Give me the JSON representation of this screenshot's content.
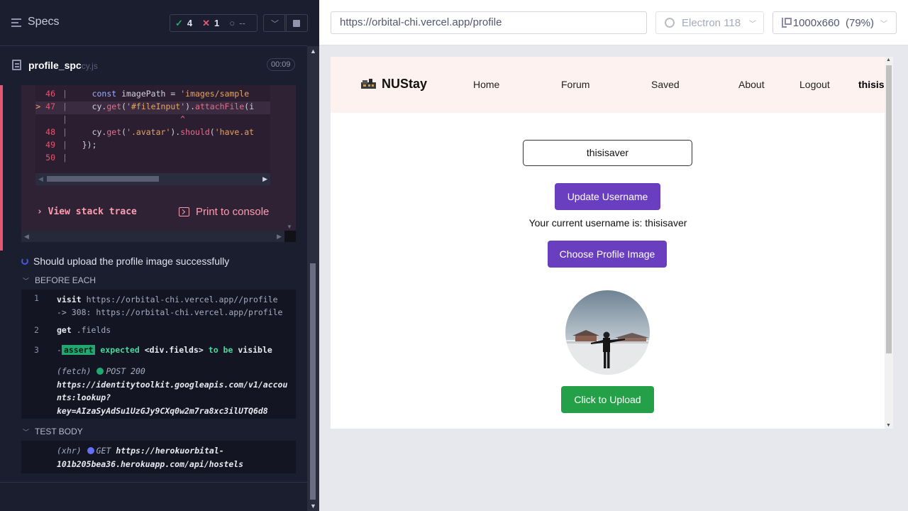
{
  "reporter": {
    "title": "Specs",
    "stats": {
      "passed": "4",
      "failed": "1",
      "pending": "--"
    },
    "spec": {
      "name": "profile_spc",
      "ext": "cy.js",
      "time": "00:09"
    },
    "code_lines": [
      {
        "num": "46",
        "marker": "",
        "code": "const imagePath = 'images/sample"
      },
      {
        "num": "47",
        "marker": ">",
        "code": "cy.get('#fileInput').attachFile(i"
      },
      {
        "num": "",
        "marker": "",
        "code": "                  ^"
      },
      {
        "num": "48",
        "marker": "",
        "code": "cy.get('.avatar').should('have.at"
      },
      {
        "num": "49",
        "marker": "",
        "code": "});"
      },
      {
        "num": "50",
        "marker": "",
        "code": ""
      }
    ],
    "view_stack_trace": "View stack trace",
    "print_to_console": "Print to console",
    "test_title": "Should upload the profile image successfully",
    "before_each_label": "BEFORE EACH",
    "before_each": {
      "visit_name": "visit",
      "visit_msg_1": "https://orbital-chi.vercel.app//profile",
      "visit_msg_2": "-> 308: https://orbital-chi.vercel.app/profile",
      "get_name": "get",
      "get_msg": ".fields",
      "assert_tag": "assert",
      "assert_expected": "expected",
      "assert_subject": "<div.fields>",
      "assert_to_be": "to be",
      "assert_visible": "visible",
      "fetch_label": "(fetch)",
      "fetch_method": "POST 200",
      "fetch_url_1": "https://identitytoolkit.googleapis.com/v1/accou",
      "fetch_url_2": "nts:lookup?",
      "fetch_url_3": "key=AIzaSyAdSu1UzGJy9CXq0w2m7ra8xc3ilUTQ6d8"
    },
    "test_body_label": "TEST BODY",
    "test_body": {
      "xhr_label": "(xhr)",
      "xhr_method": "GET",
      "xhr_url_1": "https://herokuorbital-",
      "xhr_url_2": "101b205bea36.herokuapp.com/api/hostels"
    }
  },
  "aut": {
    "url": "https://orbital-chi.vercel.app/profile",
    "browser": "Electron 118",
    "viewport": "1000x660  (79%)"
  },
  "site": {
    "brand": "NUStay",
    "nav": [
      "Home",
      "Forum",
      "Saved",
      "About",
      "Logout",
      "thisisaver"
    ],
    "username_value": "thisisaver",
    "update_button": "Update Username",
    "current_username": "Your current username is: thisisaver",
    "choose_button": "Choose Profile Image",
    "upload_button": "Click to Upload"
  }
}
